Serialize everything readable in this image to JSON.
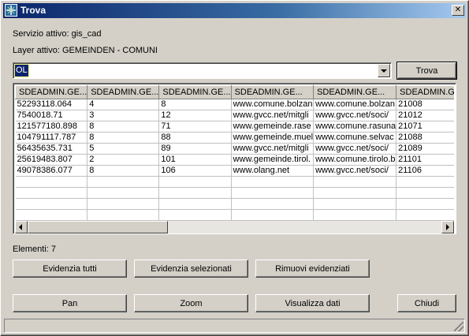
{
  "window": {
    "title": "Trova",
    "close_label": "✕"
  },
  "info": {
    "service_label": "Servizio attivo: gis_cad",
    "layer_label": "Layer attivo: GEMEINDEN - COMUNI"
  },
  "search": {
    "value": "OL",
    "button_label": "Trova"
  },
  "grid": {
    "columns": [
      "SDEADMIN.GE...",
      "SDEADMIN.GE...",
      "SDEADMIN.GE...",
      "SDEADMIN.GE...",
      "SDEADMIN.GE...",
      "SDEADMIN.GE..."
    ],
    "rows": [
      [
        "52293118.064",
        "4",
        "8",
        "www.comune.bolzan",
        "www.comune.bolzan",
        "21008"
      ],
      [
        "7540018.71",
        "3",
        "12",
        "www.gvcc.net/mitgli",
        "www.gvcc.net/soci/",
        "21012"
      ],
      [
        "121577180.898",
        "8",
        "71",
        "www.gemeinde.rase",
        "www.comune.rasuna",
        "21071"
      ],
      [
        "104791117.787",
        "8",
        "88",
        "www.gemeinde.muel",
        "www.comune.selvac",
        "21088"
      ],
      [
        "56435635.731",
        "5",
        "89",
        "www.gvcc.net/mitgli",
        "www.gvcc.net/soci/",
        "21089"
      ],
      [
        "25619483.807",
        "2",
        "101",
        "www.gemeinde.tirol.",
        "www.comune.tirolo.b",
        "21101"
      ],
      [
        "49078386.077",
        "8",
        "106",
        "www.olang.net",
        "www.gvcc.net/soci/",
        "21106"
      ],
      [
        "",
        "",
        "",
        "",
        "",
        ""
      ],
      [
        "",
        "",
        "",
        "",
        "",
        ""
      ],
      [
        "",
        "",
        "",
        "",
        "",
        ""
      ],
      [
        "",
        "",
        "",
        "",
        "",
        ""
      ]
    ]
  },
  "count_label": "Elementi: 7",
  "buttons": {
    "highlight_all": "Evidenzia tutti",
    "highlight_selected": "Evidenzia selezionati",
    "remove_highlights": "Rimuovi evidenziati",
    "pan": "Pan",
    "zoom": "Zoom",
    "view_data": "Visualizza dati",
    "close": "Chiudi"
  },
  "colors": {
    "titlebar": "#0a246a",
    "face": "#d4d0c8",
    "selection": "#0a246a"
  },
  "icons": {
    "app": "map-grid-icon",
    "close": "close-icon",
    "dropdown": "chevron-down-icon"
  }
}
